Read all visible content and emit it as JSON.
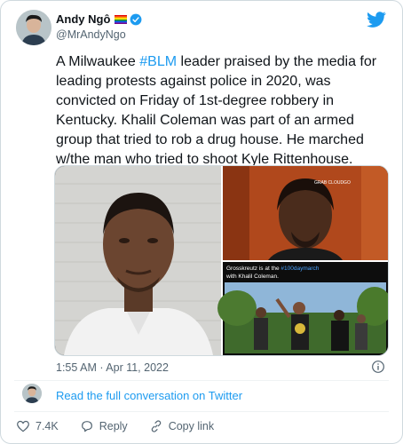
{
  "author": {
    "name": "Andy Ngô",
    "handle": "@MrAndyNgo",
    "avatar_icon": "person-avatar-icon",
    "verified_icon": "verified-badge-icon",
    "flag_icon": "rainbow-flag-icon"
  },
  "tweet": {
    "text_parts": [
      "A Milwaukee ",
      "#BLM",
      " leader praised by the media for leading protests against police in 2020, was convicted on Friday of 1st-degree robbery in Kentucky. Khalil Coleman was part of an armed group that tried to rob a drug house. He marched w/the man who tried to shoot Kyle Rittenhouse."
    ]
  },
  "media": {
    "video_watermark": "GRAB CLOUDGO",
    "caption": {
      "prefix": "Grosskreutz is at the ",
      "hashtag": "#100daymarch",
      "suffix": " with Khalil Coleman."
    }
  },
  "meta": {
    "timestamp": "1:55 AM · Apr 11, 2022",
    "info_icon": "info-icon"
  },
  "conversation": {
    "link_text": "Read the full conversation on Twitter"
  },
  "actions": {
    "like_count": "7.4K",
    "reply_label": "Reply",
    "copy_link_label": "Copy link"
  },
  "colors": {
    "accent": "#1d9bf0",
    "secondary_text": "#536471",
    "like_red": "#f91880"
  }
}
